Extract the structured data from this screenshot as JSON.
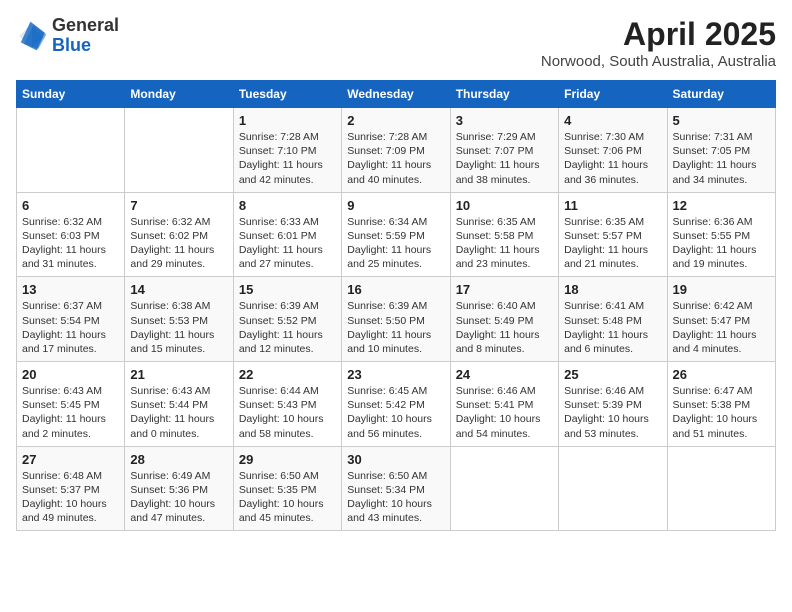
{
  "header": {
    "logo_general": "General",
    "logo_blue": "Blue",
    "title": "April 2025",
    "subtitle": "Norwood, South Australia, Australia"
  },
  "calendar": {
    "days_of_week": [
      "Sunday",
      "Monday",
      "Tuesday",
      "Wednesday",
      "Thursday",
      "Friday",
      "Saturday"
    ],
    "weeks": [
      [
        {
          "day": "",
          "info": ""
        },
        {
          "day": "",
          "info": ""
        },
        {
          "day": "1",
          "info": "Sunrise: 7:28 AM\nSunset: 7:10 PM\nDaylight: 11 hours and 42 minutes."
        },
        {
          "day": "2",
          "info": "Sunrise: 7:28 AM\nSunset: 7:09 PM\nDaylight: 11 hours and 40 minutes."
        },
        {
          "day": "3",
          "info": "Sunrise: 7:29 AM\nSunset: 7:07 PM\nDaylight: 11 hours and 38 minutes."
        },
        {
          "day": "4",
          "info": "Sunrise: 7:30 AM\nSunset: 7:06 PM\nDaylight: 11 hours and 36 minutes."
        },
        {
          "day": "5",
          "info": "Sunrise: 7:31 AM\nSunset: 7:05 PM\nDaylight: 11 hours and 34 minutes."
        }
      ],
      [
        {
          "day": "6",
          "info": "Sunrise: 6:32 AM\nSunset: 6:03 PM\nDaylight: 11 hours and 31 minutes."
        },
        {
          "day": "7",
          "info": "Sunrise: 6:32 AM\nSunset: 6:02 PM\nDaylight: 11 hours and 29 minutes."
        },
        {
          "day": "8",
          "info": "Sunrise: 6:33 AM\nSunset: 6:01 PM\nDaylight: 11 hours and 27 minutes."
        },
        {
          "day": "9",
          "info": "Sunrise: 6:34 AM\nSunset: 5:59 PM\nDaylight: 11 hours and 25 minutes."
        },
        {
          "day": "10",
          "info": "Sunrise: 6:35 AM\nSunset: 5:58 PM\nDaylight: 11 hours and 23 minutes."
        },
        {
          "day": "11",
          "info": "Sunrise: 6:35 AM\nSunset: 5:57 PM\nDaylight: 11 hours and 21 minutes."
        },
        {
          "day": "12",
          "info": "Sunrise: 6:36 AM\nSunset: 5:55 PM\nDaylight: 11 hours and 19 minutes."
        }
      ],
      [
        {
          "day": "13",
          "info": "Sunrise: 6:37 AM\nSunset: 5:54 PM\nDaylight: 11 hours and 17 minutes."
        },
        {
          "day": "14",
          "info": "Sunrise: 6:38 AM\nSunset: 5:53 PM\nDaylight: 11 hours and 15 minutes."
        },
        {
          "day": "15",
          "info": "Sunrise: 6:39 AM\nSunset: 5:52 PM\nDaylight: 11 hours and 12 minutes."
        },
        {
          "day": "16",
          "info": "Sunrise: 6:39 AM\nSunset: 5:50 PM\nDaylight: 11 hours and 10 minutes."
        },
        {
          "day": "17",
          "info": "Sunrise: 6:40 AM\nSunset: 5:49 PM\nDaylight: 11 hours and 8 minutes."
        },
        {
          "day": "18",
          "info": "Sunrise: 6:41 AM\nSunset: 5:48 PM\nDaylight: 11 hours and 6 minutes."
        },
        {
          "day": "19",
          "info": "Sunrise: 6:42 AM\nSunset: 5:47 PM\nDaylight: 11 hours and 4 minutes."
        }
      ],
      [
        {
          "day": "20",
          "info": "Sunrise: 6:43 AM\nSunset: 5:45 PM\nDaylight: 11 hours and 2 minutes."
        },
        {
          "day": "21",
          "info": "Sunrise: 6:43 AM\nSunset: 5:44 PM\nDaylight: 11 hours and 0 minutes."
        },
        {
          "day": "22",
          "info": "Sunrise: 6:44 AM\nSunset: 5:43 PM\nDaylight: 10 hours and 58 minutes."
        },
        {
          "day": "23",
          "info": "Sunrise: 6:45 AM\nSunset: 5:42 PM\nDaylight: 10 hours and 56 minutes."
        },
        {
          "day": "24",
          "info": "Sunrise: 6:46 AM\nSunset: 5:41 PM\nDaylight: 10 hours and 54 minutes."
        },
        {
          "day": "25",
          "info": "Sunrise: 6:46 AM\nSunset: 5:39 PM\nDaylight: 10 hours and 53 minutes."
        },
        {
          "day": "26",
          "info": "Sunrise: 6:47 AM\nSunset: 5:38 PM\nDaylight: 10 hours and 51 minutes."
        }
      ],
      [
        {
          "day": "27",
          "info": "Sunrise: 6:48 AM\nSunset: 5:37 PM\nDaylight: 10 hours and 49 minutes."
        },
        {
          "day": "28",
          "info": "Sunrise: 6:49 AM\nSunset: 5:36 PM\nDaylight: 10 hours and 47 minutes."
        },
        {
          "day": "29",
          "info": "Sunrise: 6:50 AM\nSunset: 5:35 PM\nDaylight: 10 hours and 45 minutes."
        },
        {
          "day": "30",
          "info": "Sunrise: 6:50 AM\nSunset: 5:34 PM\nDaylight: 10 hours and 43 minutes."
        },
        {
          "day": "",
          "info": ""
        },
        {
          "day": "",
          "info": ""
        },
        {
          "day": "",
          "info": ""
        }
      ]
    ]
  }
}
